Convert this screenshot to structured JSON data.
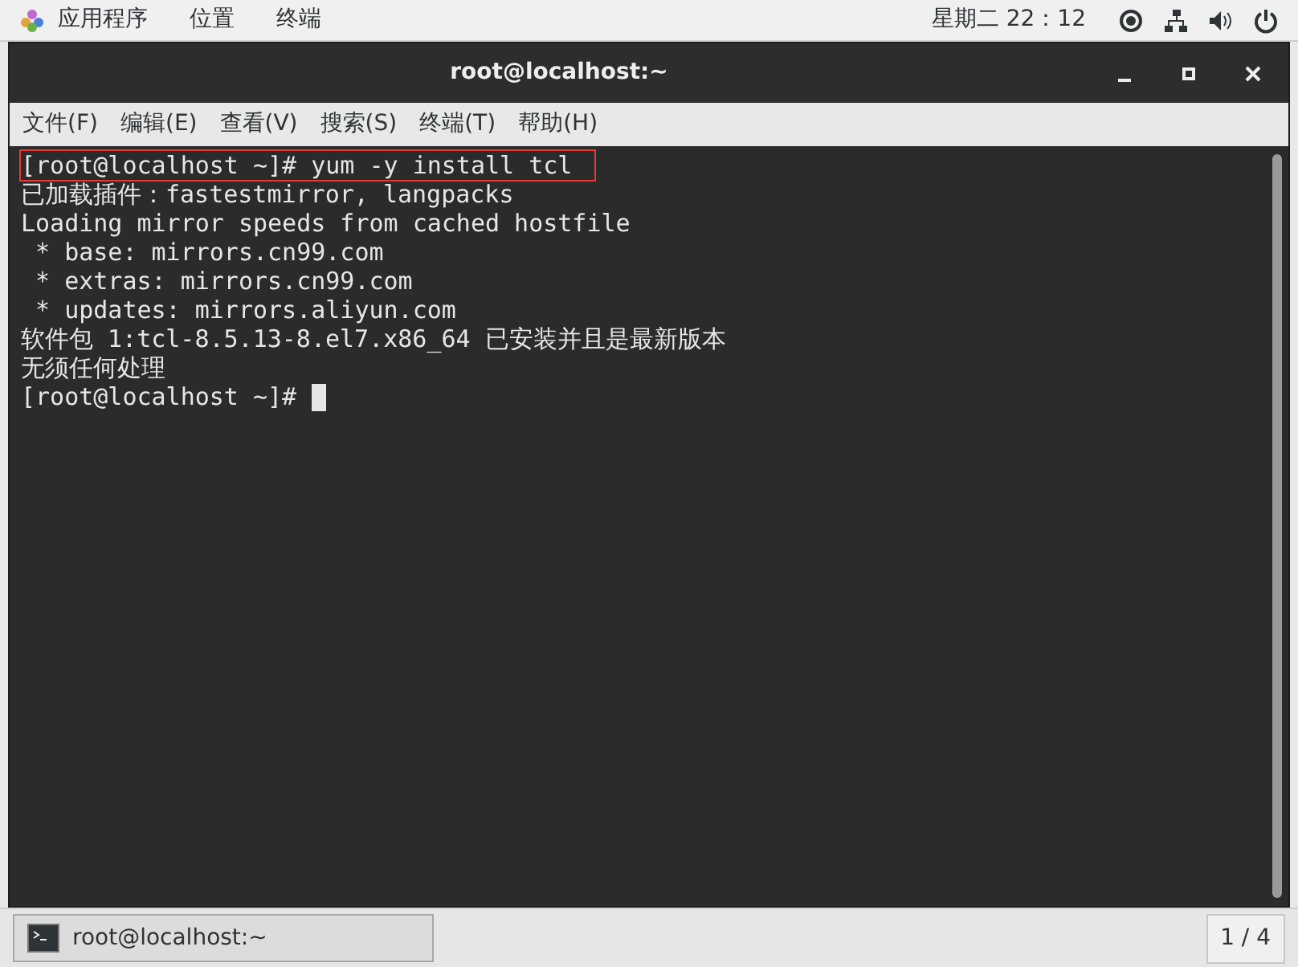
{
  "top_bar": {
    "menus": [
      "应用程序",
      "位置",
      "终端"
    ],
    "clock": "星期二 22：12"
  },
  "window": {
    "title": "root@localhost:~"
  },
  "menu_bar": [
    "文件(F)",
    "编辑(E)",
    "查看(V)",
    "搜索(S)",
    "终端(T)",
    "帮助(H)"
  ],
  "terminal": {
    "lines": [
      {
        "text": "[root@localhost ~]# yum -y install tcl",
        "highlighted": true,
        "cursor": false
      },
      {
        "text": "已加载插件：fastestmirror, langpacks",
        "highlighted": false,
        "cursor": false
      },
      {
        "text": "Loading mirror speeds from cached hostfile",
        "highlighted": false,
        "cursor": false
      },
      {
        "text": " * base: mirrors.cn99.com",
        "highlighted": false,
        "cursor": false
      },
      {
        "text": " * extras: mirrors.cn99.com",
        "highlighted": false,
        "cursor": false
      },
      {
        "text": " * updates: mirrors.aliyun.com",
        "highlighted": false,
        "cursor": false
      },
      {
        "text": "软件包 1:tcl-8.5.13-8.el7.x86_64 已安装并且是最新版本",
        "highlighted": false,
        "cursor": false
      },
      {
        "text": "无须任何处理",
        "highlighted": false,
        "cursor": false
      },
      {
        "text": "[root@localhost ~]# ",
        "highlighted": false,
        "cursor": true
      }
    ]
  },
  "taskbar": {
    "items": [
      {
        "label": "root@localhost:~",
        "selected": true
      }
    ],
    "workspace": "1 / 4"
  }
}
